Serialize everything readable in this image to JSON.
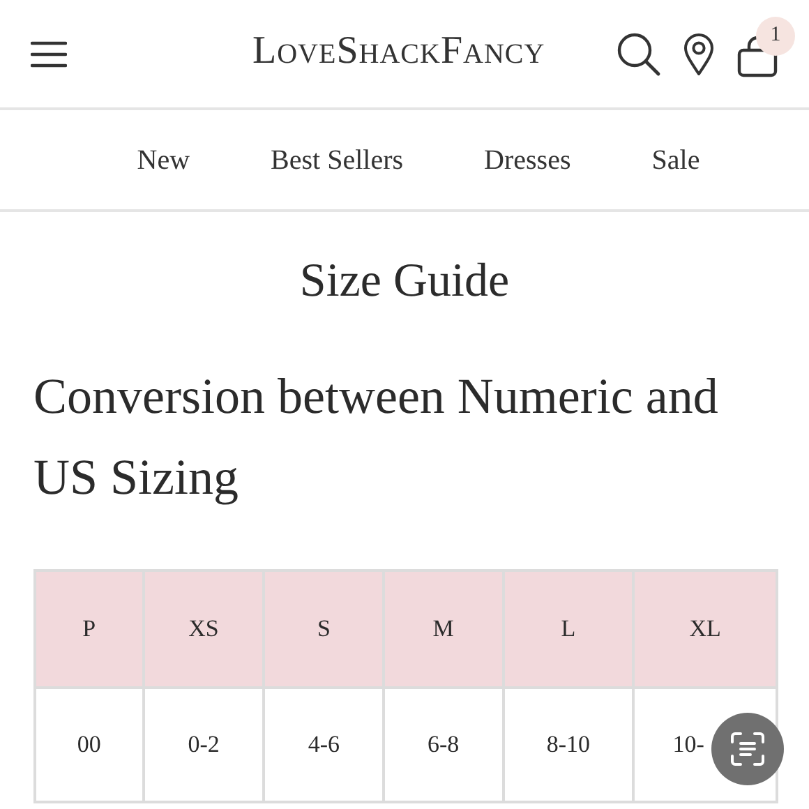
{
  "header": {
    "logo": "LoveShackFancy",
    "cart_count": "1"
  },
  "nav": [
    {
      "label": "New"
    },
    {
      "label": "Best Sellers"
    },
    {
      "label": "Dresses"
    },
    {
      "label": "Sale"
    }
  ],
  "page_title": "Size Guide",
  "section_heading": "Conversion between Numeric and US Sizing",
  "table": {
    "columns": [
      "P",
      "XS",
      "S",
      "M",
      "L",
      "XL"
    ],
    "rows": [
      [
        "00",
        "0-2",
        "4-6",
        "6-8",
        "8-10",
        "10-"
      ]
    ]
  }
}
